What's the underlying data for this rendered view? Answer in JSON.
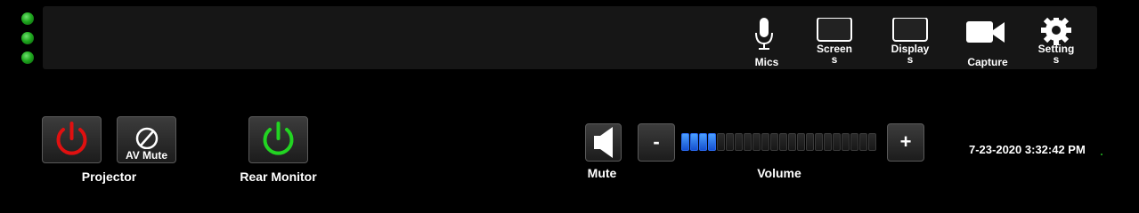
{
  "status_leds": [
    "status-led-1",
    "status-led-2",
    "status-led-3"
  ],
  "toolbar": {
    "mics_label": "Mics",
    "screens_label": "Screens",
    "displays_label": "Displays",
    "capture_label": "Capture",
    "settings_label": "Settings"
  },
  "projector": {
    "caption": "Projector",
    "av_mute_label": "AV Mute",
    "power_color": "#e01010"
  },
  "rear_monitor": {
    "caption": "Rear Monitor",
    "power_color": "#22d422"
  },
  "audio": {
    "mute_label": "Mute",
    "volume_label": "Volume",
    "minus_label": "-",
    "plus_label": "+",
    "volume_segments_total": 22,
    "volume_segments_lit": 4,
    "level_color": "#2a6af0"
  },
  "clock": {
    "datetime": "7-23-2020 3:32:42 PM"
  }
}
